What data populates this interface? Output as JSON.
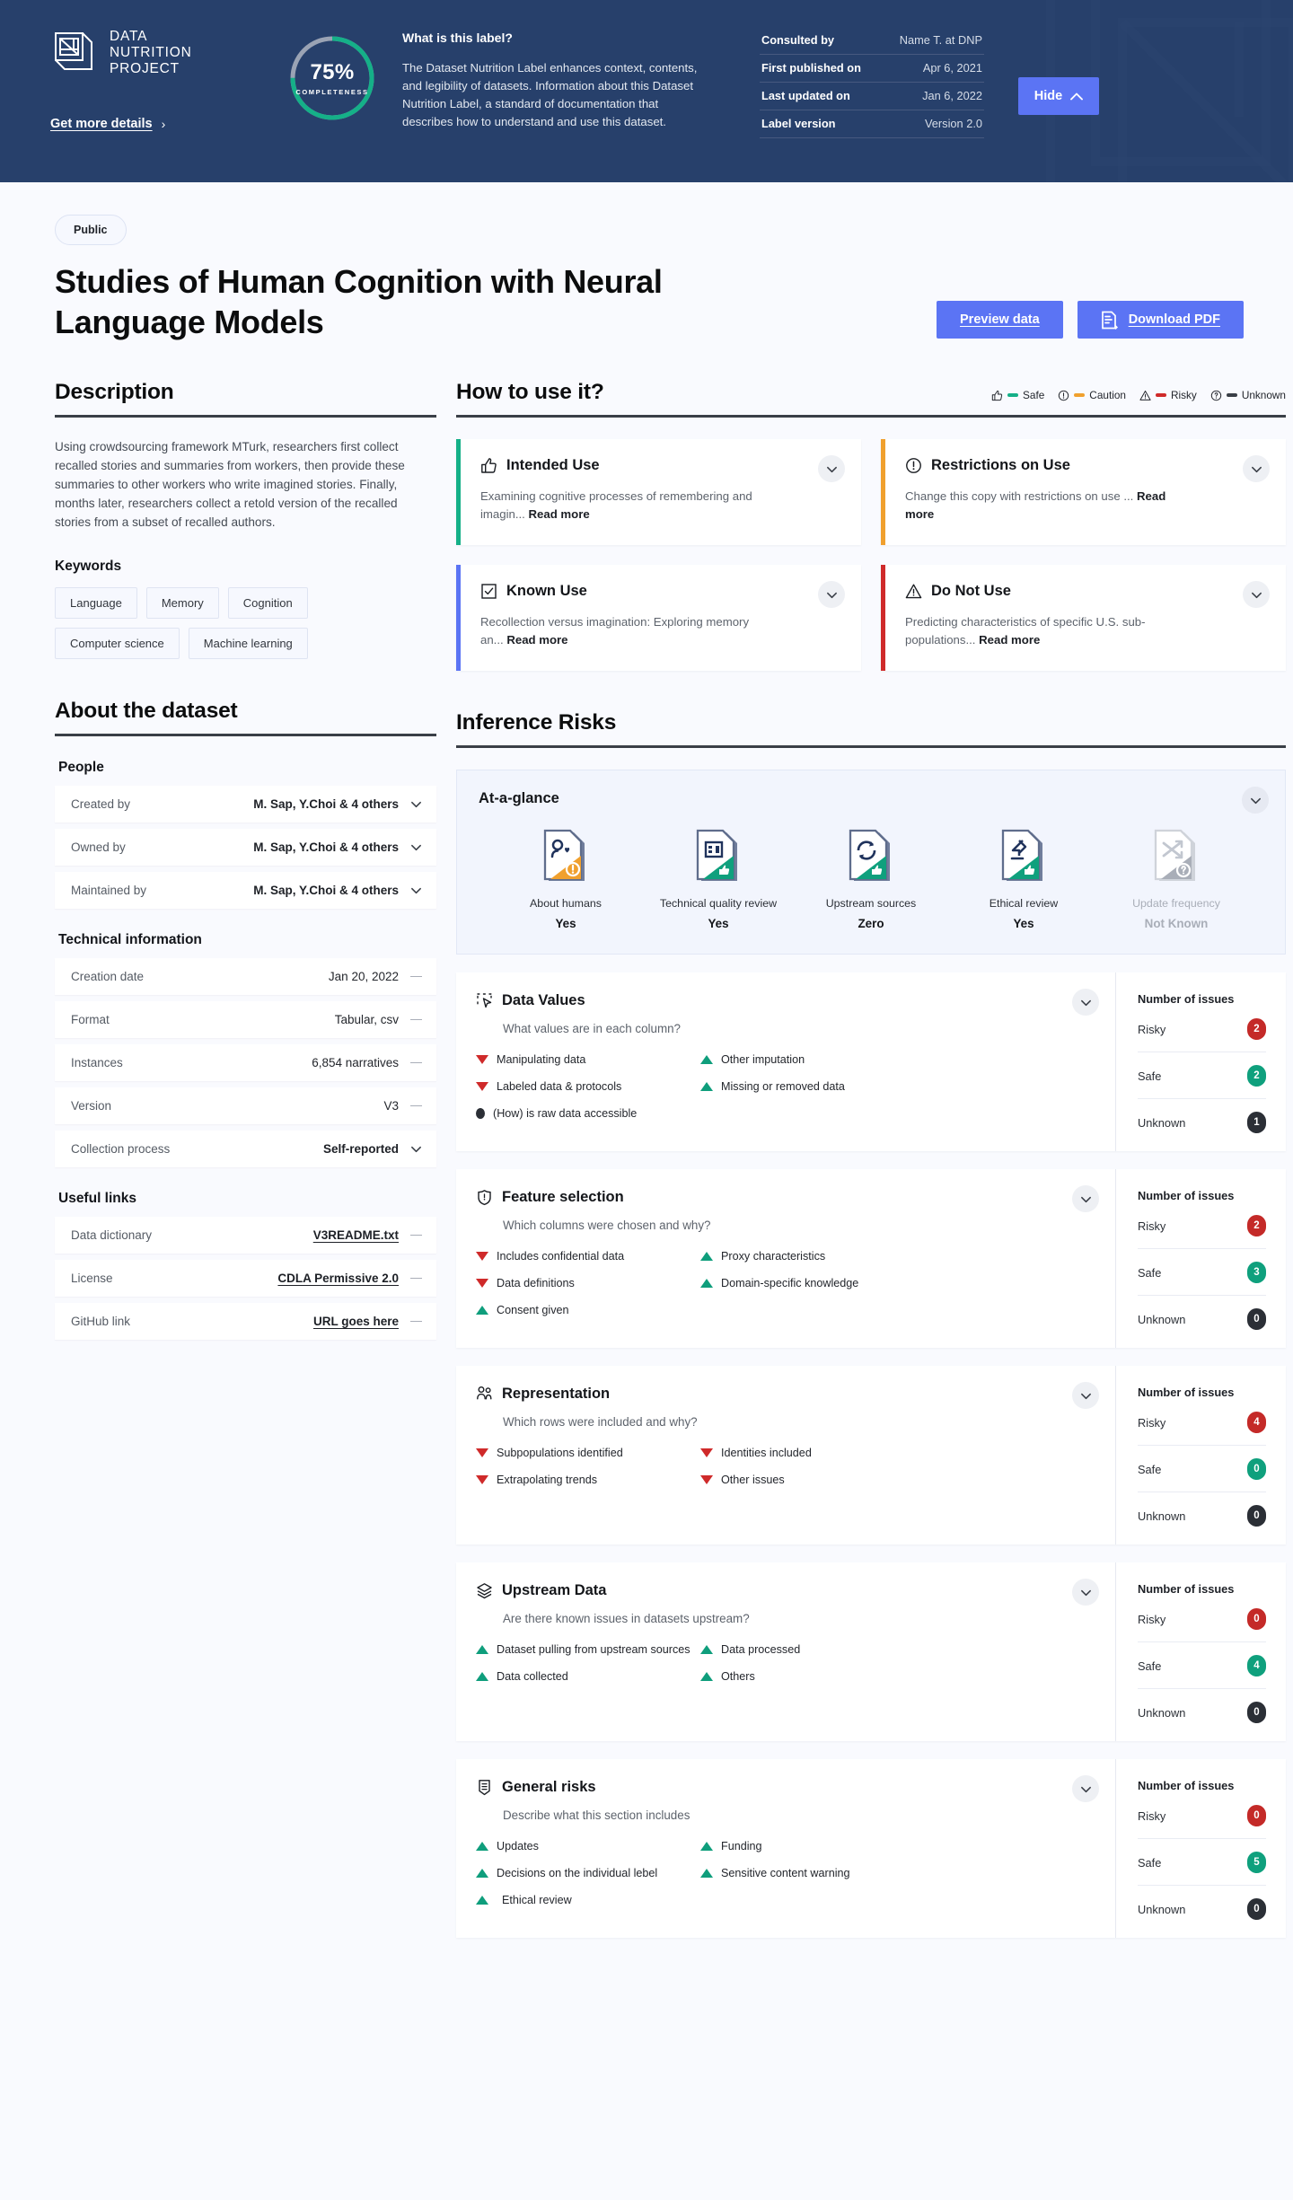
{
  "header": {
    "logo": {
      "icon": "data-nutrition-logo-icon",
      "line1": "DATA",
      "line2": "NUTRITION",
      "line3": "PROJECT"
    },
    "get_more_details": "Get more details",
    "completeness": {
      "percent": "75%",
      "caption": "COMPLETENESS",
      "value": 75,
      "ring_color": "#15b088",
      "track_color": "#9aa3b4"
    },
    "about": {
      "title": "What is this label?",
      "body": "The Dataset Nutrition Label enhances context, contents, and legibility of datasets. Information about this Dataset Nutrition Label, a standard of documentation that describes how to understand and use this dataset."
    },
    "meta": [
      {
        "key": "Consulted by",
        "value": "Name T. at DNP"
      },
      {
        "key": "First published on",
        "value": "Apr 6, 2021"
      },
      {
        "key": "Last updated on",
        "value": "Jan 6, 2022"
      },
      {
        "key": "Label version",
        "value": "Version 2.0"
      }
    ],
    "hide_button": "Hide",
    "bg_color": "#27406b",
    "accent_color": "#5b74f4"
  },
  "page": {
    "visibility_badge": "Public",
    "title": "Studies of Human Cognition with Neural Language Models",
    "actions": {
      "preview": "Preview data",
      "download": "Download PDF"
    }
  },
  "description": {
    "heading": "Description",
    "text": "Using crowdsourcing framework MTurk, researchers first collect recalled stories and summaries from workers, then provide these summaries to other workers who write imagined stories. Finally, months later, researchers collect a retold version of the recalled stories from a subset of recalled authors.",
    "keywords_heading": "Keywords",
    "keywords": [
      "Language",
      "Memory",
      "Cognition",
      "Computer science",
      "Machine learning"
    ]
  },
  "how_to_use": {
    "heading": "How to use it?",
    "legend": [
      {
        "label": "Safe",
        "color": "#15b088",
        "icon": "thumbs-up-icon"
      },
      {
        "label": "Caution",
        "color": "#f0a02e",
        "icon": "exclamation-circle-icon"
      },
      {
        "label": "Risky",
        "color": "#cf2a2a",
        "icon": "warning-triangle-icon"
      },
      {
        "label": "Unknown",
        "color": "#3a3f47",
        "icon": "question-circle-icon"
      }
    ],
    "cards": [
      {
        "title": "Intended Use",
        "icon": "thumbs-up-icon",
        "accent": "#15b088",
        "body": "Examining cognitive processes of remembering and imagin...",
        "read_more": "Read more"
      },
      {
        "title": "Restrictions on Use",
        "icon": "exclamation-circle-icon",
        "accent": "#f0a02e",
        "body": "Change this copy with restrictions on use ...",
        "read_more": "Read more"
      },
      {
        "title": "Known Use",
        "icon": "checkbox-icon",
        "accent": "#5b74f4",
        "body": "Recollection versus imagination: Exploring memory an...",
        "read_more": "Read more"
      },
      {
        "title": "Do Not Use",
        "icon": "warning-triangle-icon",
        "accent": "#cf2a2a",
        "body": "Predicting characteristics of specific U.S. sub-populations...",
        "read_more": "Read more"
      }
    ]
  },
  "about_dataset": {
    "heading": "About the dataset",
    "groups": [
      {
        "label": "People",
        "rows": [
          {
            "key": "Created by",
            "value": "M. Sap, Y.Choi & 4 others",
            "control": "chevron",
            "style": "bold"
          },
          {
            "key": "Owned by",
            "value": "M. Sap, Y.Choi & 4 others",
            "control": "chevron",
            "style": "bold"
          },
          {
            "key": "Maintained by",
            "value": "M. Sap, Y.Choi & 4 others",
            "control": "chevron",
            "style": "bold"
          }
        ]
      },
      {
        "label": "Technical information",
        "rows": [
          {
            "key": "Creation date",
            "value": "Jan 20, 2022",
            "control": "dash",
            "style": "plain"
          },
          {
            "key": "Format",
            "value": "Tabular, csv",
            "control": "dash",
            "style": "plain"
          },
          {
            "key": "Instances",
            "value": "6,854 narratives",
            "control": "dash",
            "style": "plain"
          },
          {
            "key": "Version",
            "value": "V3",
            "control": "dash",
            "style": "plain"
          },
          {
            "key": "Collection process",
            "value": "Self-reported",
            "control": "chevron",
            "style": "bold"
          }
        ]
      },
      {
        "label": "Useful links",
        "rows": [
          {
            "key": "Data dictionary",
            "value": "V3README.txt",
            "control": "dash",
            "style": "link"
          },
          {
            "key": "License",
            "value": "CDLA Permissive 2.0",
            "control": "dash",
            "style": "link"
          },
          {
            "key": "GitHub link",
            "value": "URL goes here",
            "control": "dash",
            "style": "link"
          }
        ]
      }
    ]
  },
  "inference_risks": {
    "heading": "Inference Risks",
    "at_a_glance": {
      "title": "At-a-glance",
      "items": [
        {
          "label": "About humans",
          "value": "Yes",
          "icon": "humans-doc-icon",
          "status": "caution"
        },
        {
          "label": "Technical quality review",
          "value": "Yes",
          "icon": "quality-doc-icon",
          "status": "safe"
        },
        {
          "label": "Upstream sources",
          "value": "Zero",
          "icon": "upstream-doc-icon",
          "status": "safe"
        },
        {
          "label": "Ethical review",
          "value": "Yes",
          "icon": "ethics-doc-icon",
          "status": "safe"
        },
        {
          "label": "Update frequency",
          "value": "Not Known",
          "icon": "shuffle-doc-icon",
          "status": "unknown"
        }
      ]
    },
    "issues_header": "Number of issues",
    "issue_labels": {
      "risky": "Risky",
      "safe": "Safe",
      "unknown": "Unknown"
    },
    "sections": [
      {
        "title": "Data Values",
        "icon": "data-values-icon",
        "question": "What values are in each column?",
        "items": [
          {
            "label": "Manipulating data",
            "flag": "risky"
          },
          {
            "label": "Other imputation",
            "flag": "safe"
          },
          {
            "label": "Labeled data & protocols",
            "flag": "risky"
          },
          {
            "label": "Missing or removed data",
            "flag": "safe"
          },
          {
            "label": "(How) is raw data accessible",
            "flag": "unknown"
          }
        ],
        "counts": {
          "risky": "2",
          "safe": "2",
          "unknown": "1"
        }
      },
      {
        "title": "Feature selection",
        "icon": "shield-icon",
        "question": "Which columns were chosen and why?",
        "items": [
          {
            "label": "Includes confidential data",
            "flag": "risky"
          },
          {
            "label": "Proxy characteristics",
            "flag": "safe"
          },
          {
            "label": "Data definitions",
            "flag": "risky"
          },
          {
            "label": "Domain-specific knowledge",
            "flag": "safe"
          },
          {
            "label": "Consent given",
            "flag": "safe"
          }
        ],
        "counts": {
          "risky": "2",
          "safe": "3",
          "unknown": "0"
        }
      },
      {
        "title": "Representation",
        "icon": "people-icon",
        "question": "Which rows were included and why?",
        "items": [
          {
            "label": "Subpopulations identified",
            "flag": "risky"
          },
          {
            "label": "Identities included",
            "flag": "risky"
          },
          {
            "label": "Extrapolating trends",
            "flag": "risky"
          },
          {
            "label": "Other issues",
            "flag": "risky"
          }
        ],
        "counts": {
          "risky": "4",
          "safe": "0",
          "unknown": "0"
        }
      },
      {
        "title": "Upstream Data",
        "icon": "layers-icon",
        "question": "Are there known issues in datasets upstream?",
        "items": [
          {
            "label": "Dataset pulling from upstream sources",
            "flag": "safe"
          },
          {
            "label": "Data processed",
            "flag": "safe"
          },
          {
            "label": "Data collected",
            "flag": "safe"
          },
          {
            "label": "Others",
            "flag": "safe"
          }
        ],
        "counts": {
          "risky": "0",
          "safe": "4",
          "unknown": "0"
        }
      },
      {
        "title": "General risks",
        "icon": "badge-list-icon",
        "question": "Describe what this section includes",
        "items": [
          {
            "label": "Updates",
            "flag": "safe"
          },
          {
            "label": "Funding",
            "flag": "safe"
          },
          {
            "label": "Decisions on the individual lebel",
            "flag": "safe"
          },
          {
            "label": "Sensitive content warning",
            "flag": "safe"
          },
          {
            "label": "Ethical review",
            "flag": "safe"
          }
        ],
        "counts": {
          "risky": "0",
          "safe": "5",
          "unknown": "0"
        }
      }
    ]
  }
}
